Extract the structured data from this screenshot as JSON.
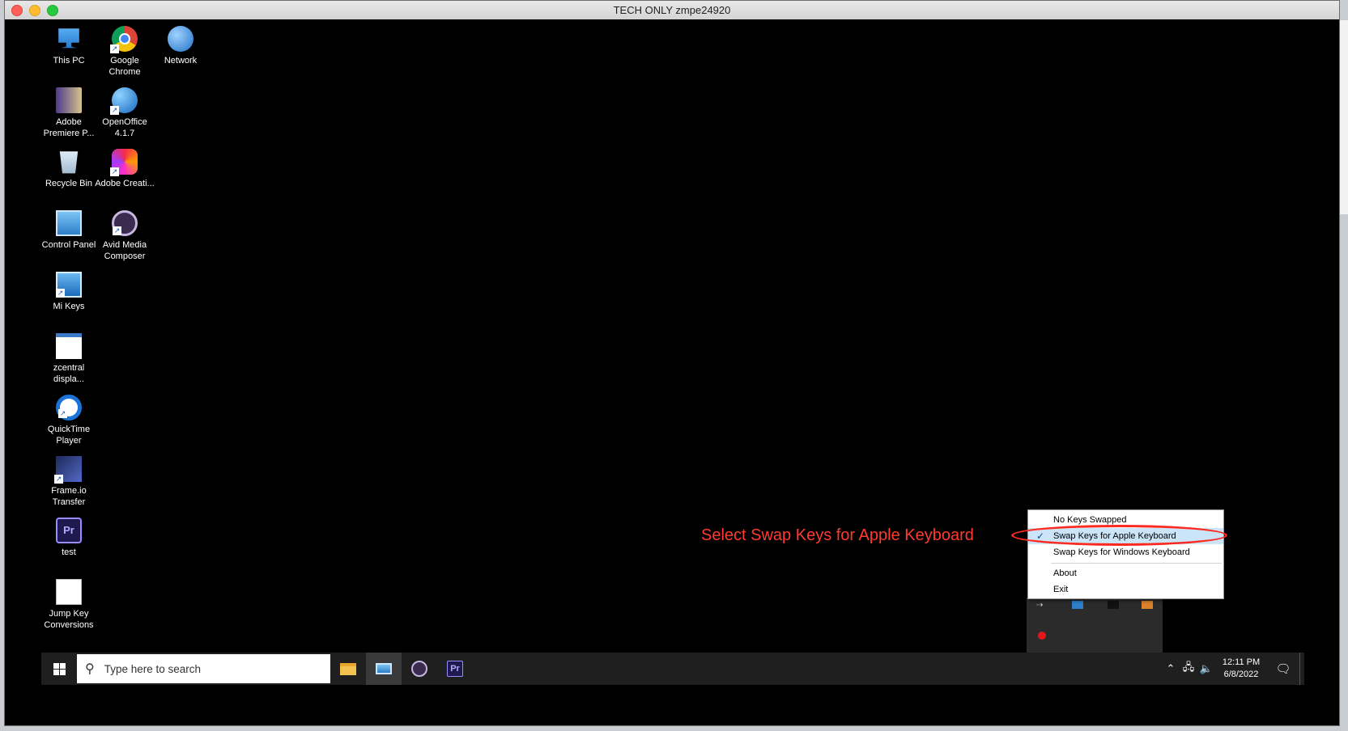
{
  "window": {
    "title": "TECH ONLY zmpe24920"
  },
  "desktop_icons": [
    {
      "label": "This PC",
      "icon": "computer-icon"
    },
    {
      "label": "Google Chrome",
      "icon": "chrome-icon"
    },
    {
      "label": "Network",
      "icon": "network-icon"
    },
    {
      "label": "Adobe Premiere P...",
      "icon": "premiere-book-icon"
    },
    {
      "label": "OpenOffice 4.1.7",
      "icon": "openoffice-icon"
    },
    {
      "label": "Recycle Bin",
      "icon": "recycle-bin-icon"
    },
    {
      "label": "Adobe Creati...",
      "icon": "creative-cloud-icon"
    },
    {
      "label": "Control Panel",
      "icon": "control-panel-icon"
    },
    {
      "label": "Avid Media Composer",
      "icon": "avid-icon"
    },
    {
      "label": "Mi Keys",
      "icon": "mikeys-icon"
    },
    {
      "label": "zcentral displa...",
      "icon": "document-icon"
    },
    {
      "label": "QuickTime Player",
      "icon": "quicktime-icon"
    },
    {
      "label": "Frame.io Transfer",
      "icon": "frameio-icon"
    },
    {
      "label": "test",
      "icon": "premiere-pro-icon"
    },
    {
      "label": "Jump Key Conversions",
      "icon": "document-icon"
    }
  ],
  "icon_text": {
    "pr": "Pr"
  },
  "context_menu": {
    "items": [
      {
        "label": "No Keys Swapped",
        "checked": false
      },
      {
        "label": "Swap Keys for Apple Keyboard",
        "checked": true
      },
      {
        "label": "Swap Keys for Windows Keyboard",
        "checked": false
      },
      {
        "label": "About",
        "checked": false
      },
      {
        "label": "Exit",
        "checked": false
      }
    ],
    "check_glyph": "✓"
  },
  "annotation": {
    "text": "Select Swap Keys for Apple Keyboard",
    "color": "#ff3b2f"
  },
  "taskbar": {
    "search_placeholder": "Type here to search",
    "pr_label": "Pr",
    "clock_time": "12:11 PM",
    "clock_date": "6/8/2022"
  }
}
